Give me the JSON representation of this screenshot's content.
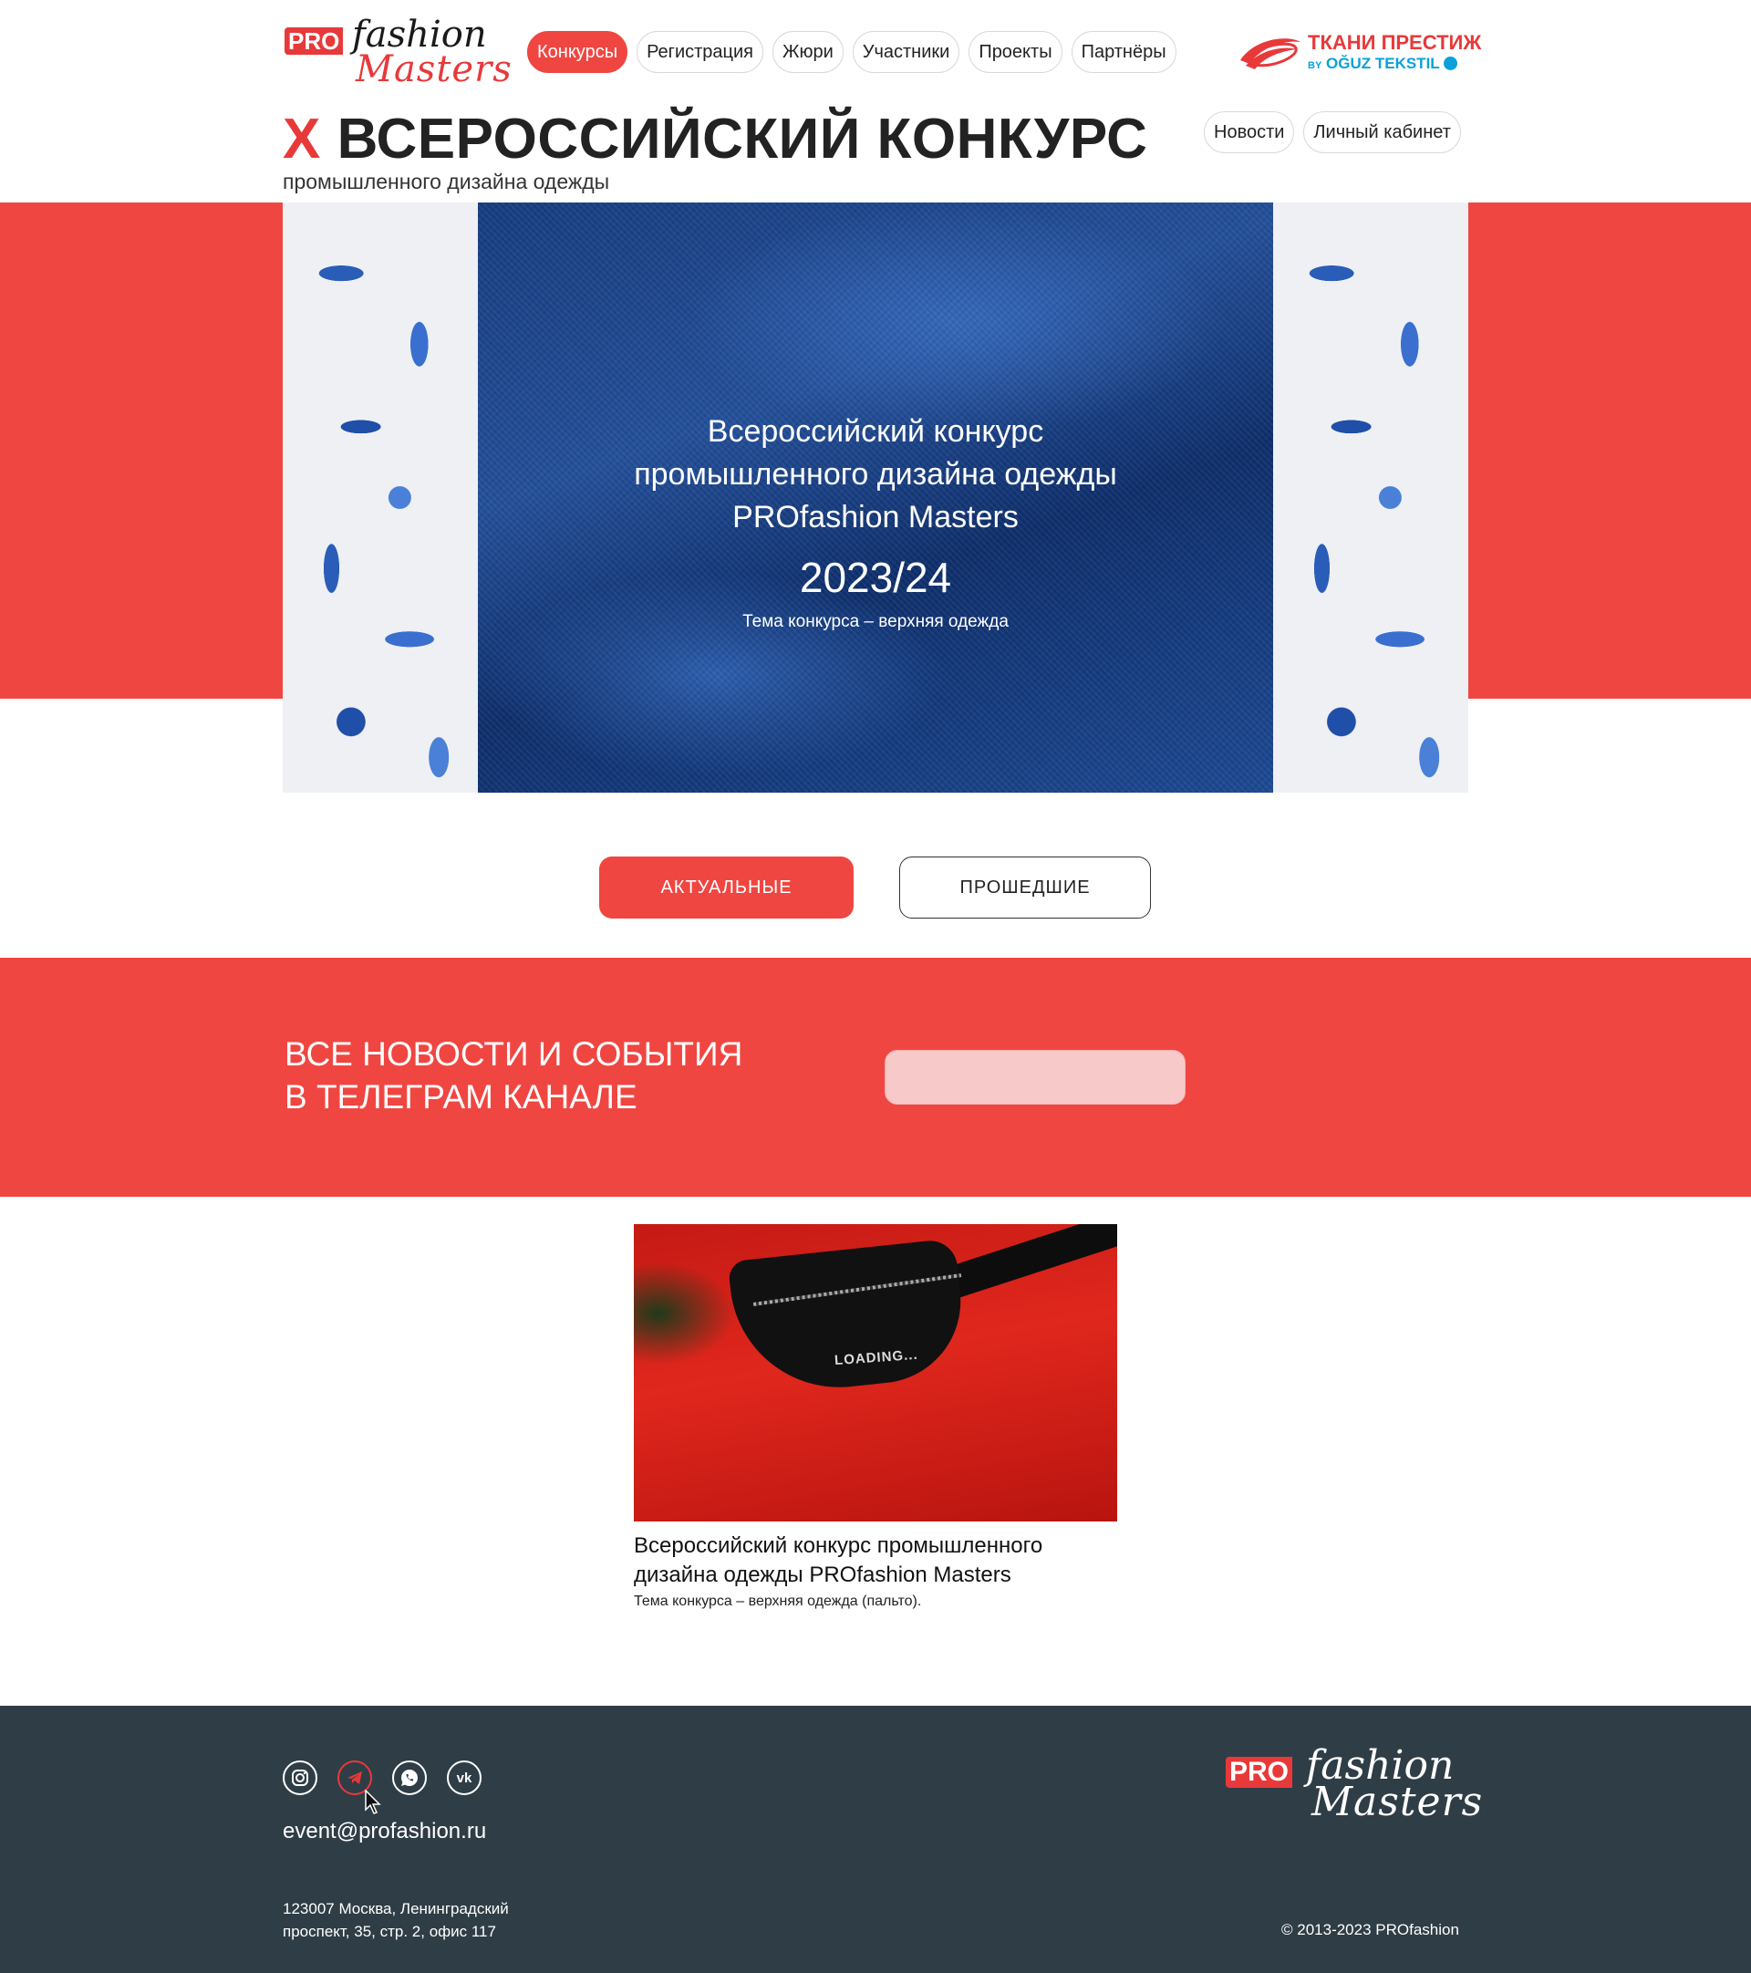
{
  "brand": {
    "logo_pro": "PRO",
    "logo_fashion": "fashion",
    "logo_masters": "Masters"
  },
  "nav": {
    "items": [
      {
        "label": "Конкурсы",
        "active": true
      },
      {
        "label": "Регистрация",
        "active": false
      },
      {
        "label": "Жюри",
        "active": false
      },
      {
        "label": "Участники",
        "active": false
      },
      {
        "label": "Проекты",
        "active": false
      },
      {
        "label": "Партнёры",
        "active": false
      }
    ]
  },
  "partner": {
    "title": "ТКАНИ ПРЕСТИЖ",
    "by": "BY",
    "name": "OĞUZ TEKSTIL"
  },
  "header": {
    "roman": "X",
    "title": "ВСЕРОССИЙСКИЙ КОНКУРС",
    "subtitle": "промышленного дизайна одежды",
    "side_links": [
      "Новости",
      "Личный кабинет"
    ]
  },
  "hero": {
    "line1": "Всероссийский конкурс",
    "line2": "промышленного дизайна одежды",
    "line3": "PROfashion Masters",
    "year": "2023/24",
    "theme": "Тема конкурса – верхняя одежда"
  },
  "tabs": {
    "actual": "АКТУАЛЬНЫЕ",
    "past": "ПРОШЕДШИЕ"
  },
  "telegram": {
    "line1": "ВСЕ НОВОСТИ И СОБЫТИЯ",
    "line2": "В ТЕЛЕГРАМ КАНАЛЕ"
  },
  "card": {
    "image_text": "LOADING...",
    "title": "Всероссийский конкурс промышленного дизайна одежды PROfashion Masters",
    "subtitle": "Тема конкурса – верхняя одежда (пальто)."
  },
  "footer": {
    "email": "event@profashion.ru",
    "address_line1": "123007 Москва, Ленинградский",
    "address_line2": "проспект, 35, стр. 2, офис 117",
    "copyright": "© 2013-2023 PROfashion",
    "social": [
      "instagram-icon",
      "telegram-icon",
      "whatsapp-icon",
      "vk-icon"
    ]
  },
  "colors": {
    "accent": "#f04641",
    "footer_bg": "#2f3d46",
    "partner_blue": "#0aa0dc"
  }
}
